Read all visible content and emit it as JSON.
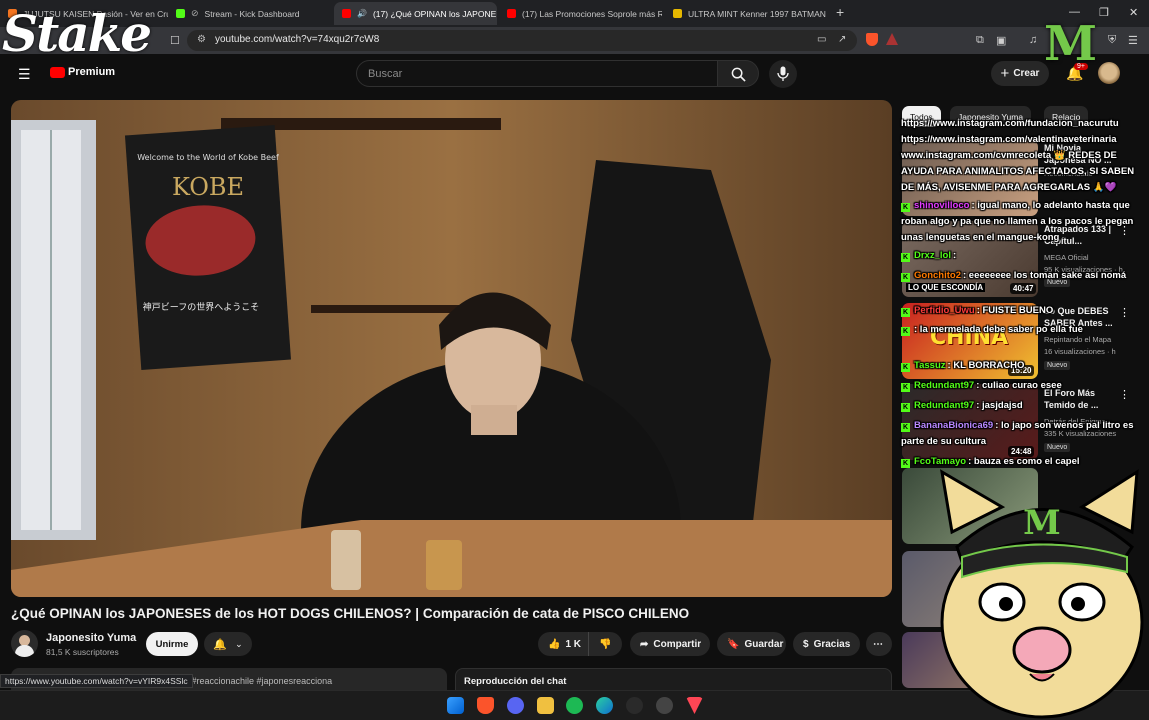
{
  "browser": {
    "tabs": [
      {
        "title": "JUJUTSU KAISEN Pasión - Ver en Cru",
        "favicon_color": "#f47521"
      },
      {
        "title": "Stream - Kick Dashboard",
        "favicon_color": "#53fc18"
      },
      {
        "title": "(17) ¿Qué OPINAN los JAPONE",
        "favicon_color": "#ff0000"
      },
      {
        "title": "(17) Las Promociones Soprole más R",
        "favicon_color": "#ff0000"
      },
      {
        "title": "ULTRA MINT Kenner 1997 BATMAN",
        "favicon_color": "#e6b800"
      }
    ],
    "new_tab": "+",
    "url": "youtube.com/watch?v=74xqu2r7cW8",
    "status_url": "https://www.youtube.com/watch?v=vYIR9x4SSlc"
  },
  "overlay": {
    "stake_logo": "Stake",
    "monster_logo": "M"
  },
  "youtube": {
    "premium_label": "Premium",
    "search_placeholder": "Buscar",
    "create_label": "Crear",
    "notification_count": "9+"
  },
  "video": {
    "poster_text_1": "Welcome to the World of Kobe Beef",
    "poster_text_2": "KOBE",
    "poster_text_3": "神戸ビーフの世界へようこそ",
    "title": "¿Qué OPINAN los JAPONESES de los HOT DOGS CHILENOS? | Comparación de cata de PISCO CHILENO",
    "channel_name": "Japonesito Yuma",
    "subscribers": "81,5 K suscriptores",
    "subscribe_label": "Unirme",
    "likes": "1 K",
    "share_label": "Compartir",
    "save_label": "Guardar",
    "thanks_label": "Gracias",
    "description_tags": "ile #reaccionachile #japonesreacciona",
    "chat_replay_label": "Reproducción del chat"
  },
  "sidebar": {
    "chips": [
      "Todos",
      "Japonesito Yuma",
      "Relacio"
    ],
    "recommendations": [
      {
        "title": "Mi Novia Japonesa NO ...",
        "meta": [
          "Recomendado",
          ""
        ],
        "duration": "",
        "badge": ""
      },
      {
        "title": "Atrapados 133 | Capítul...",
        "meta": [
          "MEGA Oficial",
          "95 K visualizaciones · h"
        ],
        "duration": "40:47",
        "badge": "Nuevo",
        "thumb_caption": "LO QUE ESCONDÍA"
      },
      {
        "title": "Lo Que DEBES SABER Antes ...",
        "meta": [
          "Repintando el Mapa",
          "16 visualizaciones · h"
        ],
        "duration": "15:20",
        "badge": "Nuevo",
        "thumb_caption": "CHINA"
      },
      {
        "title": "El Foro Más Temido de ...",
        "meta": [
          "Detrás del Enigma",
          "335 K visualizaciones"
        ],
        "duration": "24:48",
        "badge": "Nuevo",
        "thumb_caption": ""
      }
    ]
  },
  "chat": {
    "messages": [
      {
        "user": "",
        "text": "https://www.instagram.com/fundacion_nacurutu https://www.instagram.com/valentinaveterinaria www.instagram.com/cvmrecoleta 👑 REDES DE AYUDA PARA ANIMALITOS AFECTADOS, SI SABEN DE MÁS, AVISENME PARA AGREGARLAS 🙏💜",
        "color": "#ffffff"
      },
      {
        "user": "shinovilloco",
        "text": ": igual mano, lo adelanto hasta que roban algo y pa que no llamen a los pacos le pegan unas lenguetas en el mangue-kong",
        "color": "#e23bff"
      },
      {
        "user": "Drxz_lol",
        "text": ":",
        "color": "#53fc18"
      },
      {
        "user": "Gonchito2",
        "text": ": eeeeeeee los toman sake así nomá",
        "color": "#ff7a00"
      },
      {
        "user": "Perfidio_Uwu",
        "text": ": FUISTE BUENO",
        "color": "#ff3b3b"
      },
      {
        "user": "",
        "text": ": la mermelada debe saber po ella fue",
        "color": "#ffffff"
      },
      {
        "user": "Tassuz",
        "text": ": KL BORRACHO",
        "color": "#53fc18"
      },
      {
        "user": "Redundant97",
        "text": ": culiao curao esee",
        "color": "#53fc18"
      },
      {
        "user": "Redundant97",
        "text": ": jasjdajsd",
        "color": "#53fc18"
      },
      {
        "user": "BananaBionica69",
        "text": ": lo japo son wenos pal litro es parte de su cultura",
        "color": "#b987ff"
      },
      {
        "user": "FcoTamayo",
        "text": ": bauza es como el capel",
        "color": "#53fc18"
      }
    ]
  },
  "colors": {
    "accent": "#ff0000",
    "kick_green": "#53fc18",
    "background": "#0f0f0f"
  }
}
